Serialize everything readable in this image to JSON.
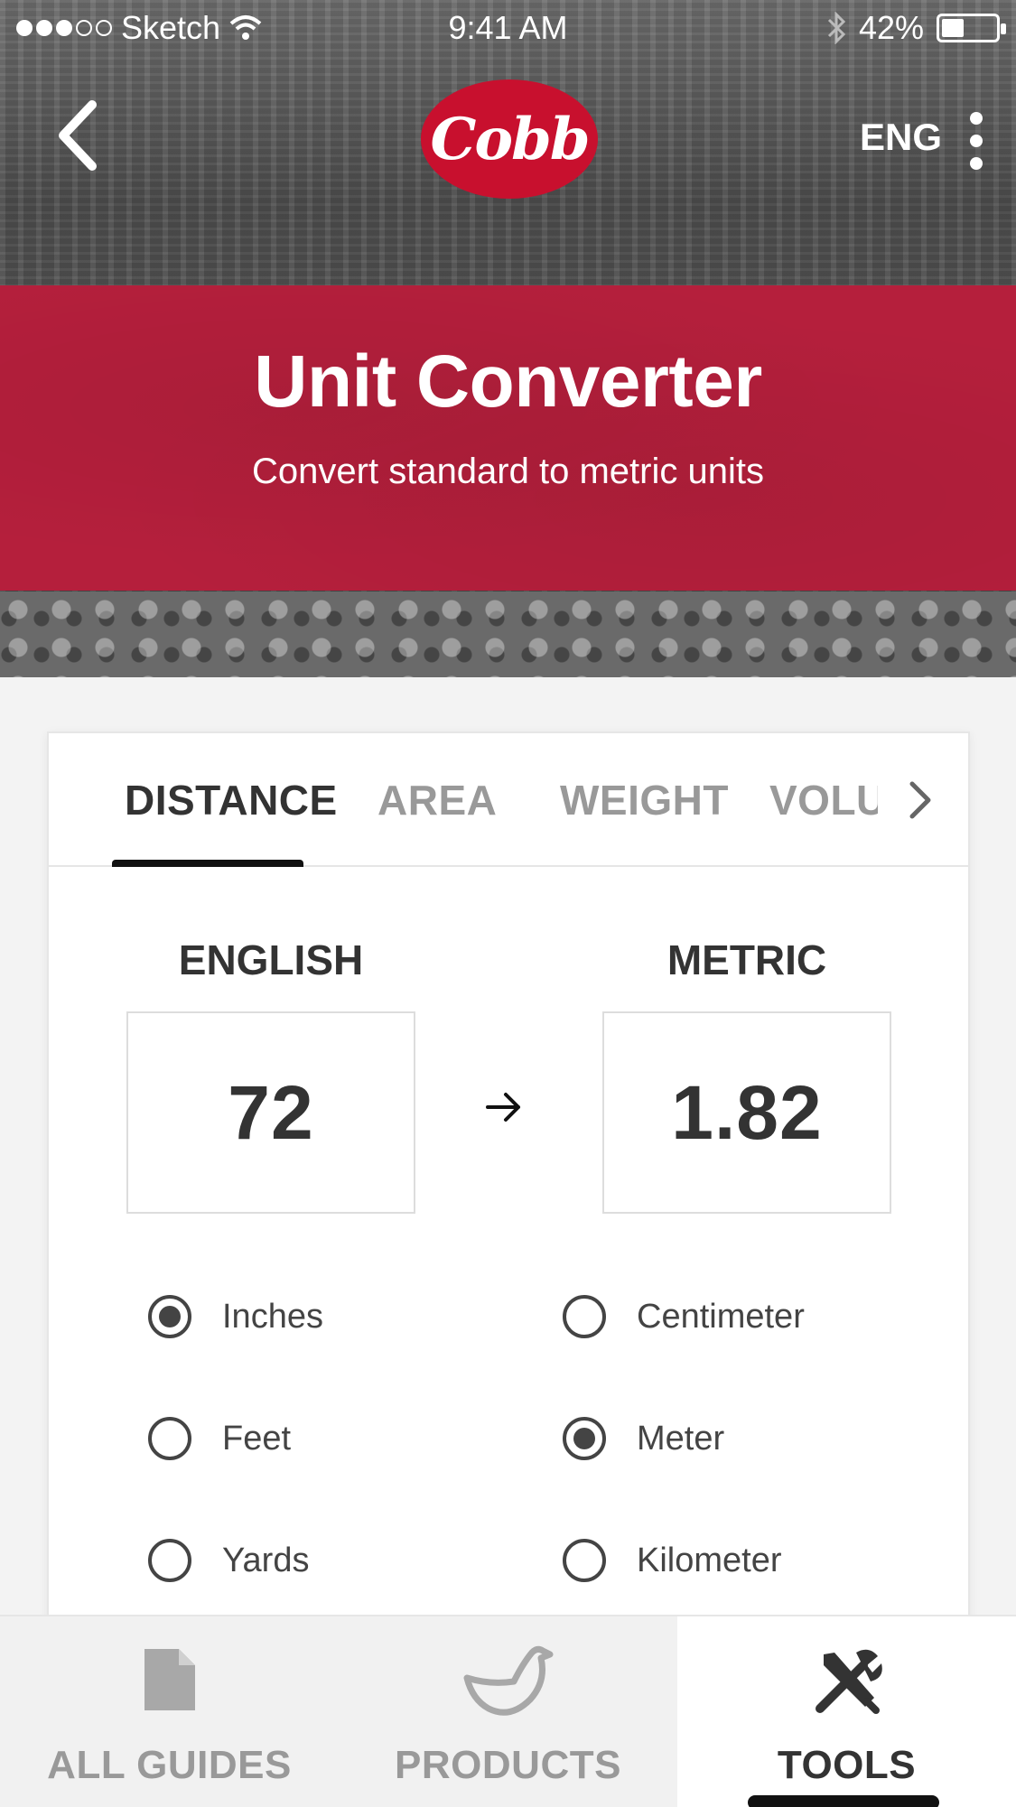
{
  "status_bar": {
    "carrier": "Sketch",
    "time": "9:41 AM",
    "battery_text": "42%",
    "battery_level": 0.42
  },
  "header": {
    "logo_text": "Cobb",
    "language": "ENG"
  },
  "banner": {
    "title": "Unit Converter",
    "subtitle": "Convert standard to metric units"
  },
  "tabs": [
    {
      "label": "DISTANCE",
      "active": true
    },
    {
      "label": "AREA",
      "active": false
    },
    {
      "label": "WEIGHT",
      "active": false
    },
    {
      "label": "VOLUM",
      "active": false
    }
  ],
  "converter": {
    "english_label": "ENGLISH",
    "metric_label": "METRIC",
    "english_value": "72",
    "metric_value": "1.82",
    "english_units": [
      {
        "label": "Inches",
        "checked": true
      },
      {
        "label": "Feet",
        "checked": false
      },
      {
        "label": "Yards",
        "checked": false
      }
    ],
    "metric_units": [
      {
        "label": "Centimeter",
        "checked": false
      },
      {
        "label": "Meter",
        "checked": true
      },
      {
        "label": "Kilometer",
        "checked": false
      }
    ]
  },
  "bottom_nav": [
    {
      "label": "ALL GUIDES",
      "icon": "document-icon",
      "active": false
    },
    {
      "label": "PRODUCTS",
      "icon": "chicken-icon",
      "active": false
    },
    {
      "label": "TOOLS",
      "icon": "tools-icon",
      "active": true
    }
  ],
  "colors": {
    "brand_red": "#c8102e",
    "banner_red": "#b51f3c"
  }
}
